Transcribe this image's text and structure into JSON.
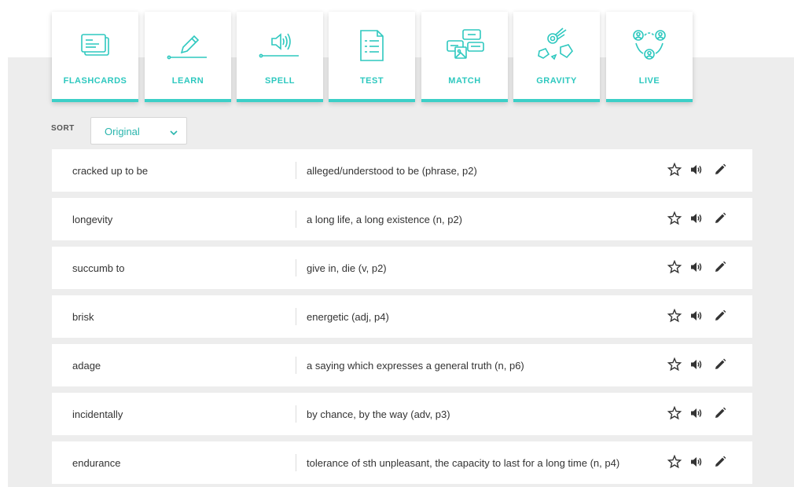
{
  "modes": [
    {
      "label": "FLASHCARDS",
      "icon": "flashcards-icon"
    },
    {
      "label": "LEARN",
      "icon": "learn-pencil-icon"
    },
    {
      "label": "SPELL",
      "icon": "spell-speaker-icon"
    },
    {
      "label": "TEST",
      "icon": "test-document-icon"
    },
    {
      "label": "MATCH",
      "icon": "match-cards-icon"
    },
    {
      "label": "GRAVITY",
      "icon": "gravity-asteroid-icon"
    },
    {
      "label": "LIVE",
      "icon": "live-people-icon"
    }
  ],
  "sort": {
    "label": "SORT",
    "value": "Original"
  },
  "terms": [
    {
      "term": "cracked up to be",
      "definition": "alleged/understood to be (phrase, p2)"
    },
    {
      "term": "longevity",
      "definition": "a long life, a long existence (n, p2)"
    },
    {
      "term": "succumb to",
      "definition": "give in, die (v, p2)"
    },
    {
      "term": "brisk",
      "definition": "energetic (adj, p4)"
    },
    {
      "term": "adage",
      "definition": "a saying which expresses a general truth (n, p6)"
    },
    {
      "term": "incidentally",
      "definition": "by chance, by the way (adv, p3)"
    },
    {
      "term": "endurance",
      "definition": "tolerance of sth unpleasant, the capacity to last for a long time (n, p4)"
    }
  ],
  "colors": {
    "accent": "#3ccfc7",
    "accent_text": "#2ec8bf",
    "page_bg": "#ededed"
  }
}
